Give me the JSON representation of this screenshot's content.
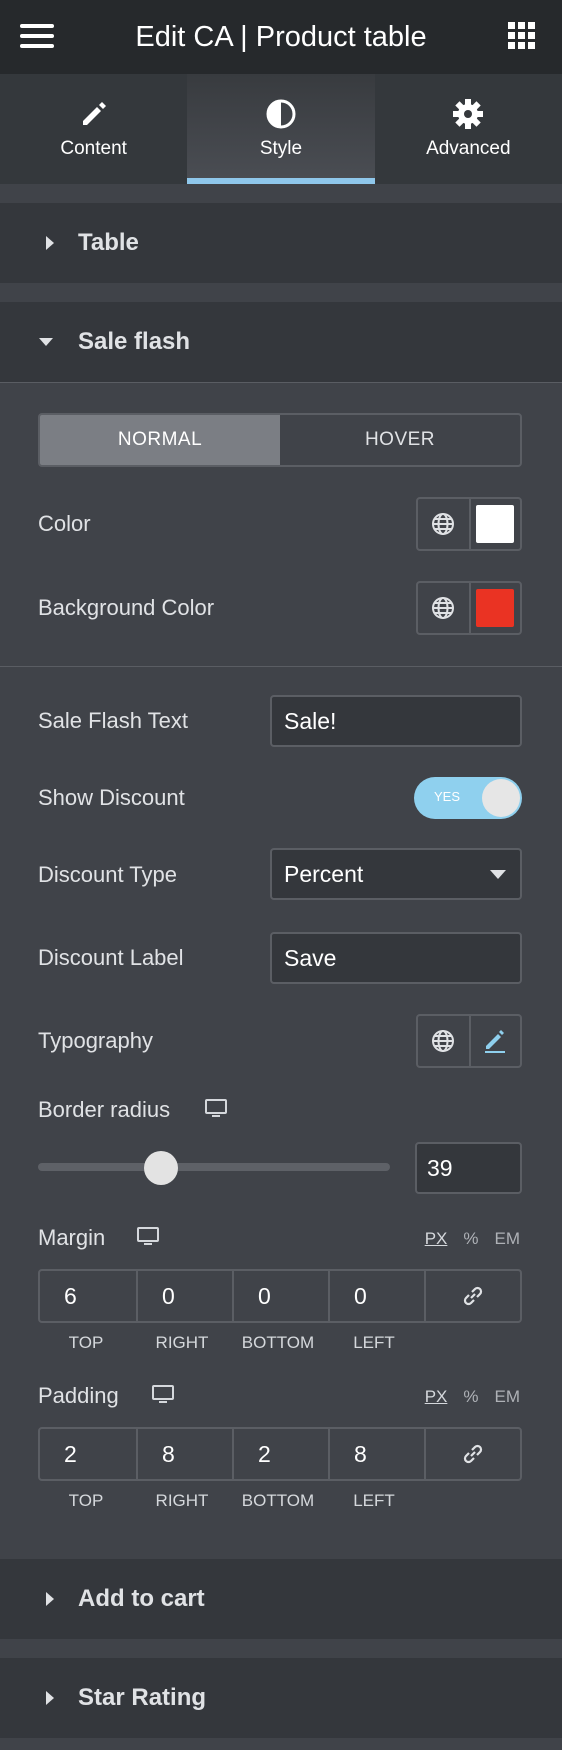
{
  "header": {
    "title": "Edit CA | Product table",
    "menu_icon": "hamburger-icon",
    "grid_icon": "apps-grid-icon"
  },
  "tabs": [
    {
      "label": "Content",
      "icon": "pencil-icon"
    },
    {
      "label": "Style",
      "icon": "half-circle-icon",
      "active": true
    },
    {
      "label": "Advanced",
      "icon": "gear-icon"
    }
  ],
  "sections": {
    "table": "Table",
    "sale_flash": "Sale flash",
    "add_to_cart": "Add to cart",
    "star_rating": "Star Rating"
  },
  "state_tabs": {
    "normal": "NORMAL",
    "hover": "HOVER",
    "active": "NORMAL"
  },
  "fields": {
    "color": {
      "label": "Color",
      "value": "#ffffff"
    },
    "background_color": {
      "label": "Background Color",
      "value": "#ea3323"
    },
    "sale_flash_text": {
      "label": "Sale Flash Text",
      "value": "Sale!"
    },
    "show_discount": {
      "label": "Show Discount",
      "toggle": "YES",
      "on": true
    },
    "discount_type": {
      "label": "Discount Type",
      "value": "Percent"
    },
    "discount_label": {
      "label": "Discount Label",
      "value": "Save"
    },
    "typography": {
      "label": "Typography"
    },
    "border_radius": {
      "label": "Border radius",
      "value": "39",
      "slider_fraction": 0.35
    },
    "margin": {
      "label": "Margin",
      "units": [
        "PX",
        "%",
        "EM"
      ],
      "unit_selected": "PX",
      "values": [
        "6",
        "0",
        "0",
        "0"
      ],
      "sides": [
        "TOP",
        "RIGHT",
        "BOTTOM",
        "LEFT"
      ]
    },
    "padding": {
      "label": "Padding",
      "units": [
        "PX",
        "%",
        "EM"
      ],
      "unit_selected": "PX",
      "values": [
        "2",
        "8",
        "2",
        "8"
      ],
      "sides": [
        "TOP",
        "RIGHT",
        "BOTTOM",
        "LEFT"
      ]
    }
  },
  "colors": {
    "accent": "#8fc7eb",
    "toggle_on": "#8fd0ee",
    "panel": "#404349",
    "header": "#26292c"
  }
}
